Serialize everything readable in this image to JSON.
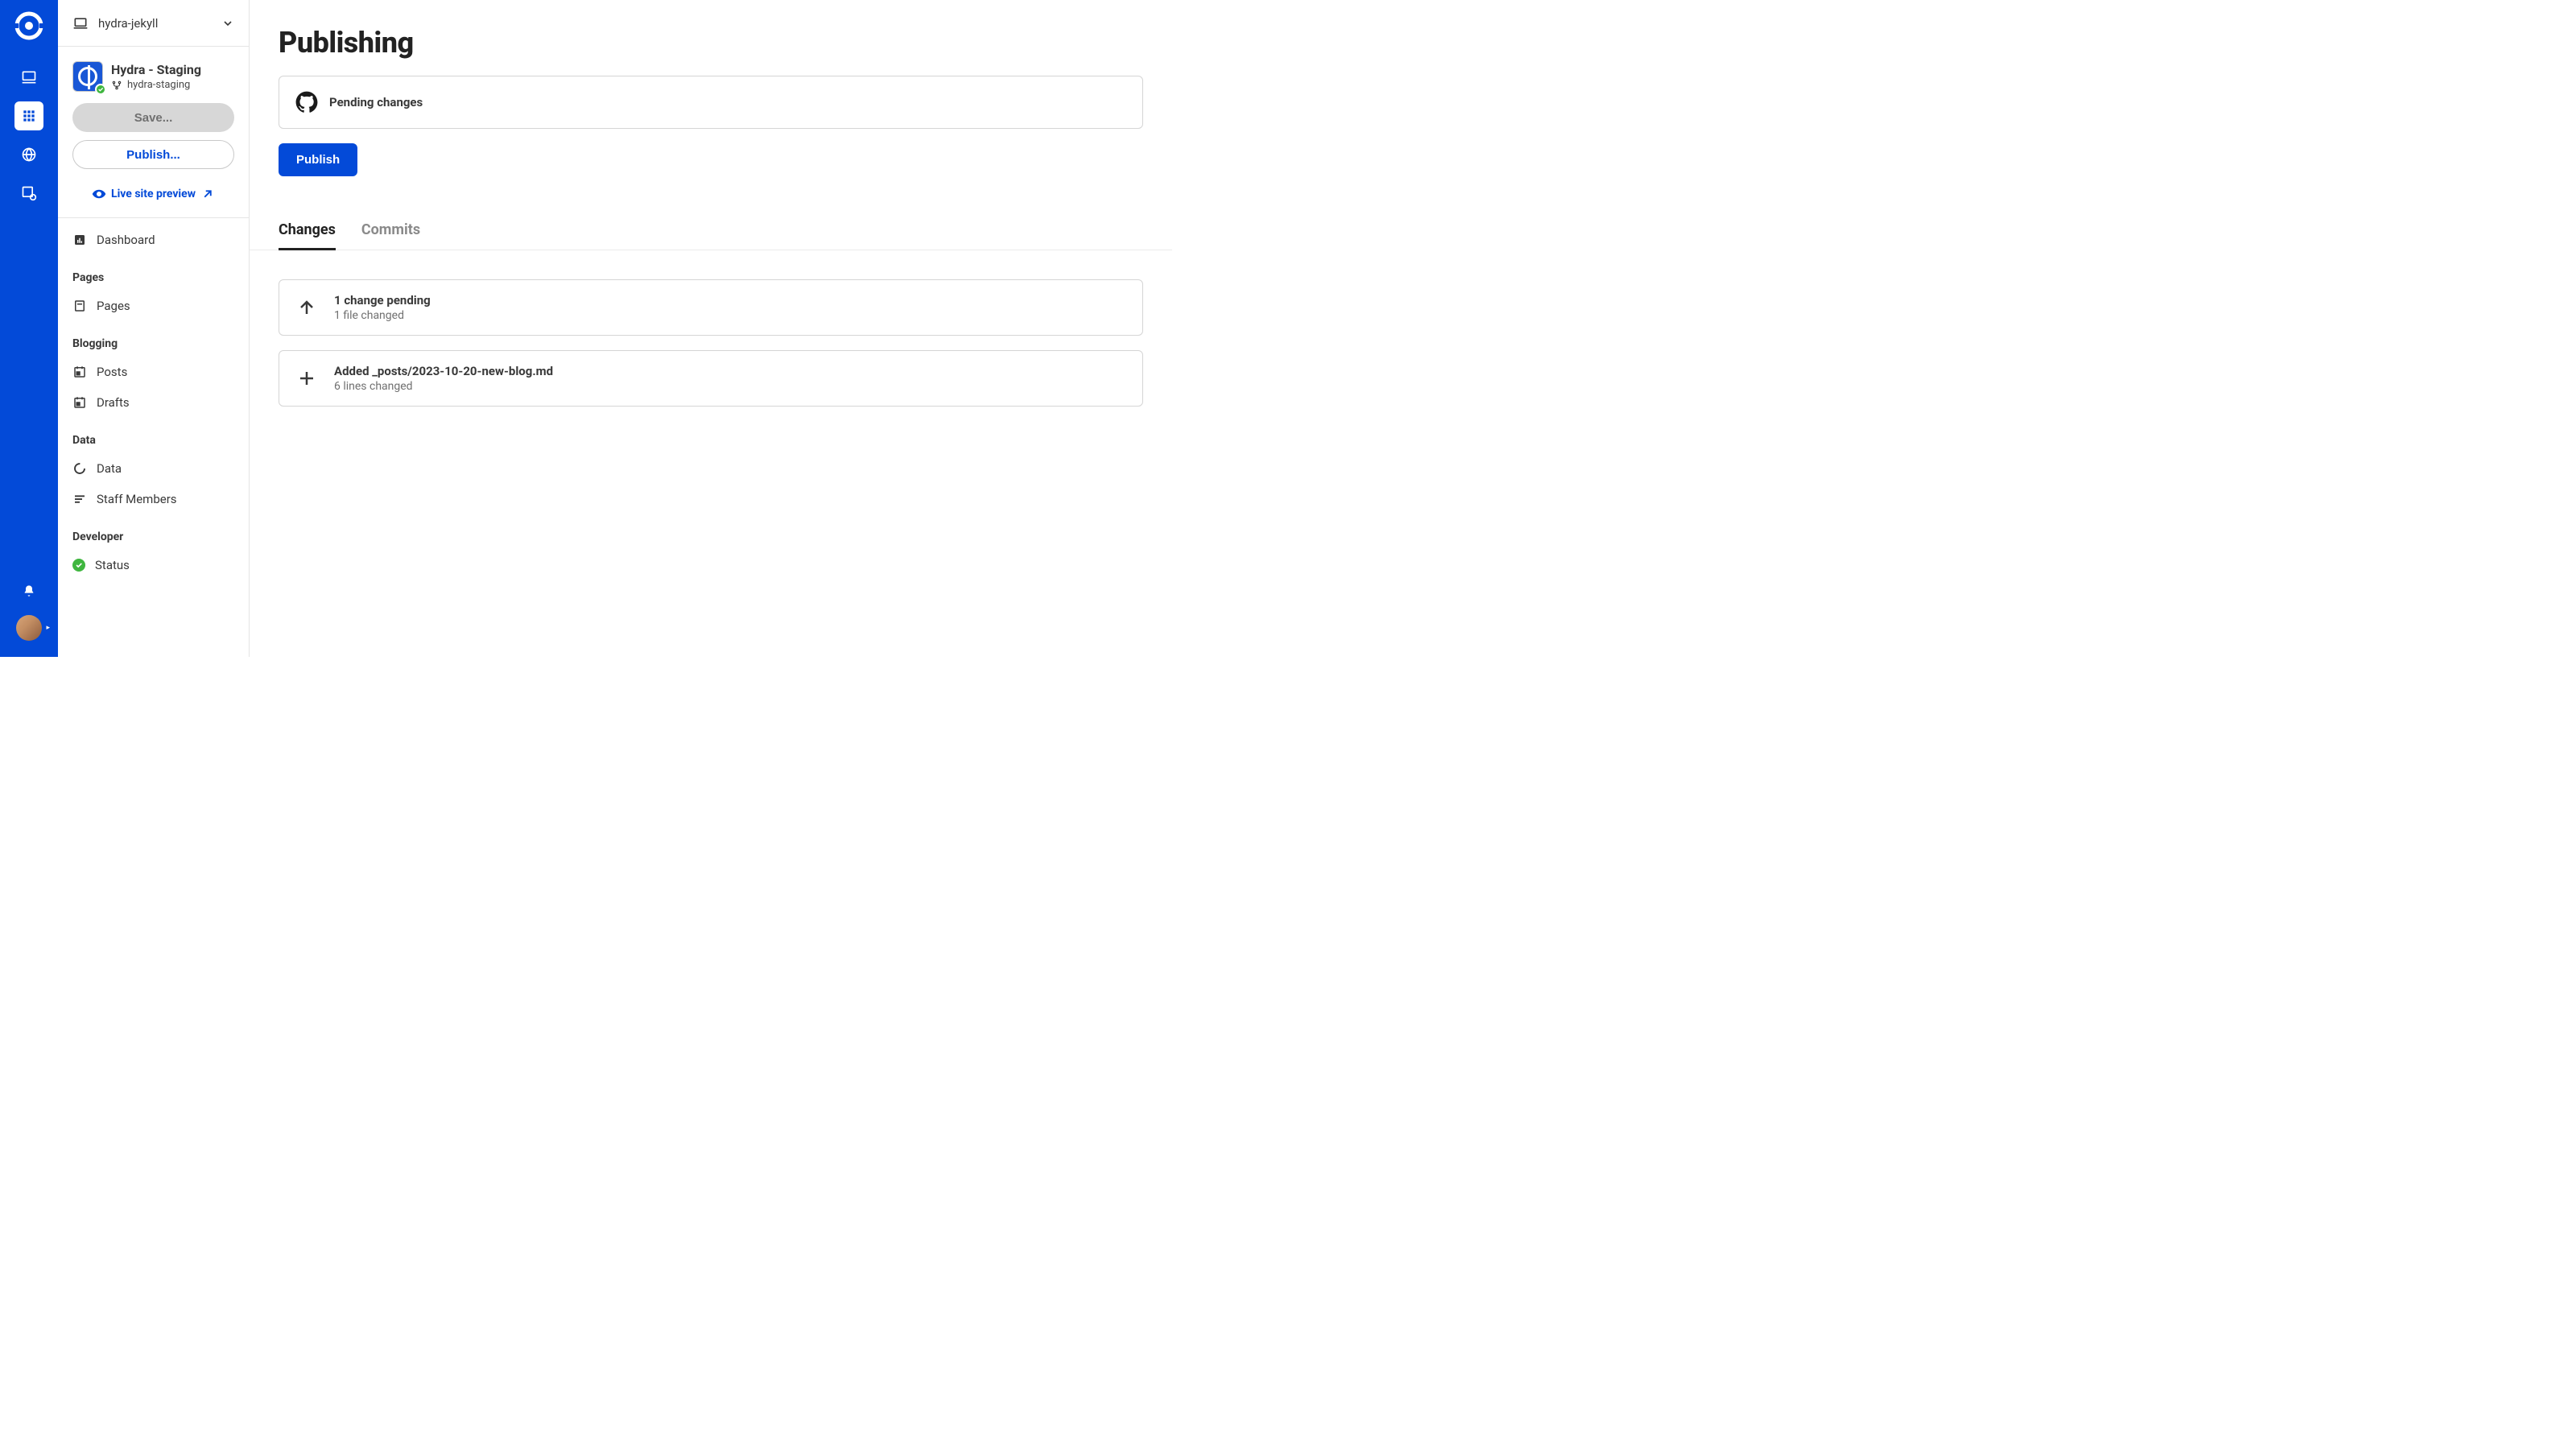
{
  "site_switcher": {
    "name": "hydra-jekyll"
  },
  "project": {
    "title": "Hydra - Staging",
    "branch": "hydra-staging"
  },
  "actions": {
    "save_label": "Save...",
    "publish_label": "Publish...",
    "live_preview_label": "Live site preview"
  },
  "nav": {
    "dashboard": "Dashboard",
    "sections": [
      {
        "heading": "Pages",
        "items": [
          {
            "label": "Pages",
            "icon": "page"
          }
        ]
      },
      {
        "heading": "Blogging",
        "items": [
          {
            "label": "Posts",
            "icon": "calendar"
          },
          {
            "label": "Drafts",
            "icon": "calendar"
          }
        ]
      },
      {
        "heading": "Data",
        "items": [
          {
            "label": "Data",
            "icon": "data"
          },
          {
            "label": "Staff Members",
            "icon": "list"
          }
        ]
      },
      {
        "heading": "Developer",
        "items": [
          {
            "label": "Status",
            "icon": "status"
          }
        ]
      }
    ]
  },
  "page": {
    "title": "Publishing",
    "pending_label": "Pending changes",
    "publish_btn": "Publish",
    "tabs": [
      {
        "label": "Changes",
        "active": true
      },
      {
        "label": "Commits",
        "active": false
      }
    ],
    "changes": [
      {
        "icon": "arrow-up",
        "title": "1 change pending",
        "subtitle": "1 file changed"
      },
      {
        "icon": "plus",
        "title": "Added _posts/2023-10-20-new-blog.md",
        "subtitle": "6 lines changed"
      }
    ]
  }
}
